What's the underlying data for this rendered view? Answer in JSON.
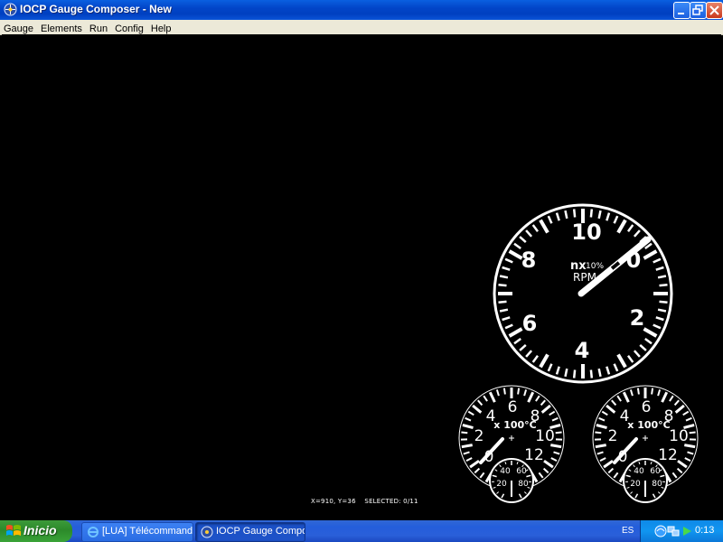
{
  "window": {
    "title": "IOCP Gauge Composer - New"
  },
  "menu": {
    "items": [
      "Gauge",
      "Elements",
      "Run",
      "Config",
      "Help"
    ]
  },
  "canvas": {
    "status_text": "X=910, Y=36    SELECTED: 0/11"
  },
  "rpm_gauge": {
    "numbers": [
      "10",
      "8",
      "0",
      "6",
      "2",
      "4"
    ],
    "unit_line1_prefix": "nx",
    "unit_line1_suffix": "10%",
    "unit_line2": "RPM"
  },
  "temp_gauges": [
    {
      "numbers": [
        "6",
        "4",
        "8",
        "2",
        "10",
        "0",
        "12"
      ],
      "unit": "x 100°C",
      "sub_numbers": [
        "40",
        "60",
        "20",
        "80"
      ]
    },
    {
      "numbers": [
        "6",
        "4",
        "8",
        "2",
        "10",
        "0",
        "12"
      ],
      "unit": "x 100°C",
      "sub_numbers": [
        "40",
        "60",
        "20",
        "80"
      ]
    }
  ],
  "taskbar": {
    "start_label": "Inicio",
    "tasks": [
      {
        "label": "[LUA] Télécommande..."
      },
      {
        "label": "IOCP Gauge Compos..."
      }
    ],
    "language": "ES",
    "clock": "0:13"
  }
}
